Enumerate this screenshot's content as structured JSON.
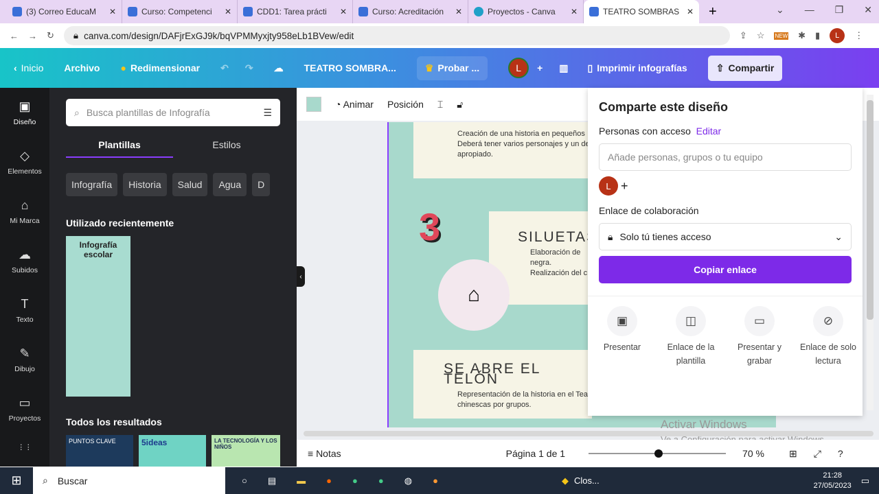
{
  "browser": {
    "tabs": [
      "(3) Correo EducaM",
      "Curso: Competenci",
      "CDD1: Tarea prácti",
      "Curso: Acreditación",
      "Proyectos - Canva",
      "TEATRO SOMBRAS"
    ],
    "url": "canva.com/design/DAFjrExGJ9k/bqVPMMyxjty958eLb1BVew/edit",
    "profile": "L",
    "ext_badge": "NEW"
  },
  "topbar": {
    "home": "Inicio",
    "file": "Archivo",
    "resize": "Redimensionar",
    "title": "TEATRO SOMBRA...",
    "try": "Probar ...",
    "avatar": "L",
    "plus": "+",
    "print": "Imprimir infografías",
    "share": "Compartir"
  },
  "rail": [
    {
      "label": "Diseño",
      "icon": "layout-icon"
    },
    {
      "label": "Elementos",
      "icon": "shapes-icon"
    },
    {
      "label": "Mi Marca",
      "icon": "brand-icon"
    },
    {
      "label": "Subidos",
      "icon": "upload-icon"
    },
    {
      "label": "Texto",
      "icon": "text-icon"
    },
    {
      "label": "Dibujo",
      "icon": "draw-icon"
    },
    {
      "label": "Proyectos",
      "icon": "folder-icon"
    }
  ],
  "panel": {
    "search_placeholder": "Busca plantillas de Infografía",
    "tabs": [
      "Plantillas",
      "Estilos"
    ],
    "chips": [
      "Infografía",
      "Historia",
      "Salud",
      "Agua",
      "D"
    ],
    "recent": "Utilizado recientemente",
    "recent_thumb_title": "Infografía escolar",
    "all": "Todos los resultados",
    "results": [
      "PUNTOS CLAVE",
      "5ideas",
      "LA TECNOLOGÍA Y LOS NIÑOS"
    ]
  },
  "toolbar": {
    "animate": "Animar",
    "position": "Posición",
    "color": "#a8d9cc"
  },
  "design": {
    "b1": "Creación de una historia en pequeños",
    "b2": "Deberá tener varios personajes y un de",
    "b2b": "apropiado.",
    "num": "3",
    "siluetas": "SILUETAS",
    "s1": "Elaboración de",
    "s1b": "negra.",
    "s2": "Realización del c",
    "telon": "SE ABRE EL TELÓN",
    "t1": "Representación de la historia en el Tea",
    "t1b": "chinescas por grupos."
  },
  "share": {
    "title": "Comparte este diseño",
    "people": "Personas con acceso",
    "edit": "Editar",
    "input_placeholder": "Añade personas, grupos o tu equipo",
    "avatar": "L",
    "collab": "Enlace de colaboración",
    "access": "Solo tú tienes acceso",
    "copy": "Copiar enlace",
    "options": [
      {
        "label": "Presentar",
        "icon": "present-icon"
      },
      {
        "label": "Enlace de la plantilla",
        "icon": "template-icon"
      },
      {
        "label": "Presentar y grabar",
        "icon": "camera-icon"
      },
      {
        "label": "Enlace de solo lectura",
        "icon": "link-icon"
      }
    ],
    "accent": "#8b3dff"
  },
  "bottom": {
    "notes": "Notas",
    "page": "Página 1 de 1",
    "zoom": "70 %",
    "zoom_value": 70
  },
  "watermark": {
    "l1": "Activar Windows",
    "l2": "Ve a Configuración para activar Windows."
  },
  "taskbar": {
    "search": "Buscar",
    "app": "Clos...",
    "time": "21:28",
    "date": "27/05/2023"
  }
}
